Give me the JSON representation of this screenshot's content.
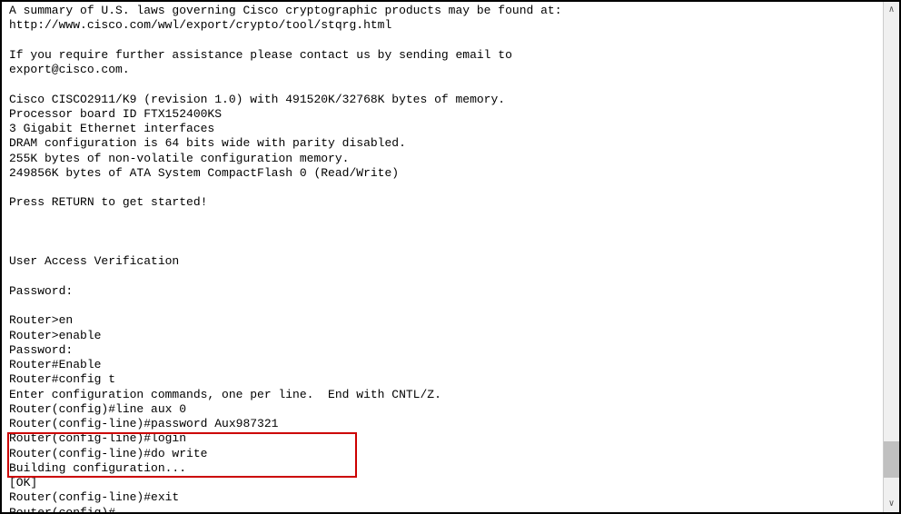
{
  "terminal": {
    "lines": [
      "A summary of U.S. laws governing Cisco cryptographic products may be found at:",
      "http://www.cisco.com/wwl/export/crypto/tool/stqrg.html",
      "",
      "If you require further assistance please contact us by sending email to",
      "export@cisco.com.",
      "",
      "Cisco CISCO2911/K9 (revision 1.0) with 491520K/32768K bytes of memory.",
      "Processor board ID FTX152400KS",
      "3 Gigabit Ethernet interfaces",
      "DRAM configuration is 64 bits wide with parity disabled.",
      "255K bytes of non-volatile configuration memory.",
      "249856K bytes of ATA System CompactFlash 0 (Read/Write)",
      "",
      "Press RETURN to get started!",
      "",
      "",
      "",
      "User Access Verification",
      "",
      "Password:",
      "",
      "Router>en",
      "Router>enable",
      "Password:",
      "Router#Enable",
      "Router#config t",
      "Enter configuration commands, one per line.  End with CNTL/Z.",
      "Router(config)#line aux 0",
      "Router(config-line)#password Aux987321",
      "Router(config-line)#login",
      "Router(config-line)#do write",
      "Building configuration...",
      "[OK]",
      "Router(config-line)#exit",
      "Router(config)#"
    ]
  },
  "highlight": {
    "label": "highlighted-commands"
  },
  "scrollbar": {
    "up": "∧",
    "down": "∨"
  }
}
